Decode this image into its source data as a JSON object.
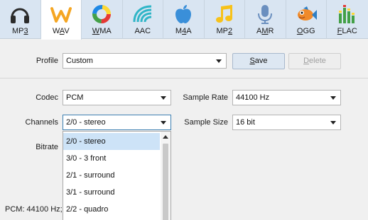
{
  "tabs": [
    {
      "id": "mp3",
      "label": "MP3",
      "icon": "headphones-icon",
      "underline": 2,
      "active": false
    },
    {
      "id": "wav",
      "label": "WAV",
      "icon": "wav-w-icon",
      "underline": 1,
      "active": true
    },
    {
      "id": "wma",
      "label": "WMA",
      "icon": "wma-ring-icon",
      "underline": 0,
      "active": false
    },
    {
      "id": "aac",
      "label": "AAC",
      "icon": "aac-wave-icon",
      "underline": -1,
      "active": false
    },
    {
      "id": "m4a",
      "label": "M4A",
      "icon": "apple-icon",
      "underline": 1,
      "active": false
    },
    {
      "id": "mp2",
      "label": "MP2",
      "icon": "music-note-icon",
      "underline": 2,
      "active": false
    },
    {
      "id": "amr",
      "label": "AMR",
      "icon": "microphone-icon",
      "underline": 1,
      "active": false
    },
    {
      "id": "ogg",
      "label": "OGG",
      "icon": "fish-icon",
      "underline": 0,
      "active": false
    },
    {
      "id": "flac",
      "label": "FLAC",
      "icon": "equalizer-icon",
      "underline": 0,
      "active": false
    }
  ],
  "profile": {
    "label": "Profile",
    "value": "Custom",
    "save": "Save",
    "save_underline": 0,
    "delete": "Delete",
    "delete_underline": 0
  },
  "codec": {
    "label": "Codec",
    "value": "PCM"
  },
  "sample_rate": {
    "label": "Sample Rate",
    "value": "44100 Hz"
  },
  "channels": {
    "label": "Channels",
    "value": "2/0 - stereo"
  },
  "sample_size": {
    "label": "Sample Size",
    "value": "16 bit"
  },
  "bitrate": {
    "label": "Bitrate"
  },
  "channel_options": [
    "2/0 - stereo",
    "3/0 - 3 front",
    "2/1 - surround",
    "3/1 - surround",
    "2/2 - quadro"
  ],
  "channel_selected_index": 0,
  "status": "PCM: 44100  Hz;",
  "colors": {
    "tab_strip": "#d9e5f2",
    "wav_icon": "#f5a623",
    "aac_icon": "#2fb5c7",
    "m4a_icon": "#3a8fd9",
    "mp2_icon": "#f7c21a",
    "amr_icon": "#6a8fbf",
    "ogg_icon": "#f08a2a",
    "list_selection": "#cde3f7"
  }
}
